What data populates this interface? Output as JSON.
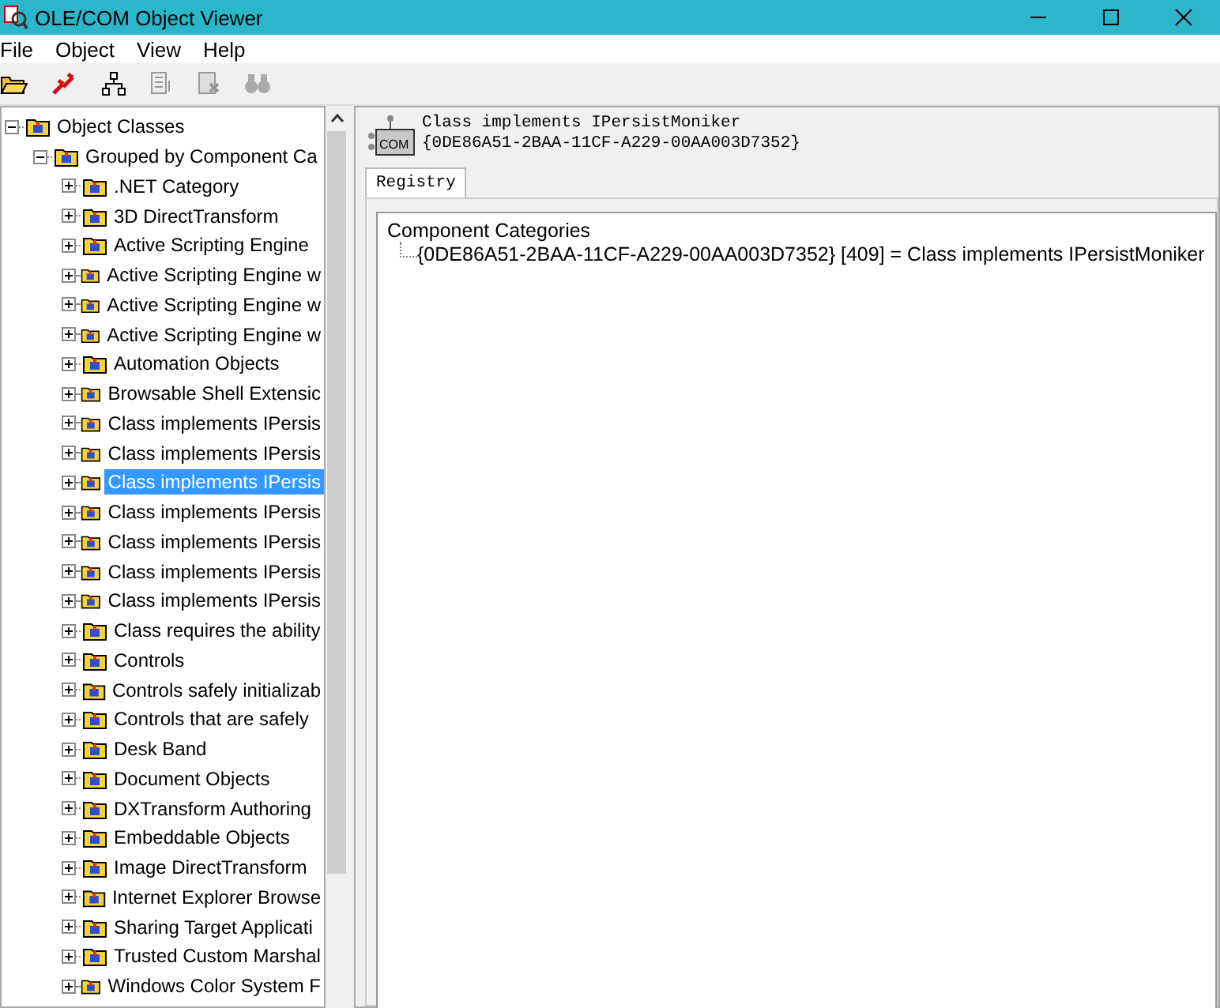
{
  "window": {
    "title": "OLE/COM Object Viewer"
  },
  "menu": [
    "File",
    "Object",
    "View",
    "Help"
  ],
  "tree": [
    {
      "label": "Object Classes",
      "expanded": true,
      "selected": false,
      "children": [
        {
          "label": "Grouped by Component Ca",
          "expanded": true,
          "selected": false,
          "children": [
            {
              "label": ".NET Category",
              "expanded": false,
              "selected": false
            },
            {
              "label": "3D DirectTransform",
              "expanded": false,
              "selected": false
            },
            {
              "label": "Active Scripting Engine",
              "expanded": false,
              "selected": false
            },
            {
              "label": "Active Scripting Engine w",
              "expanded": false,
              "selected": false
            },
            {
              "label": "Active Scripting Engine w",
              "expanded": false,
              "selected": false
            },
            {
              "label": "Active Scripting Engine w",
              "expanded": false,
              "selected": false
            },
            {
              "label": "Automation Objects",
              "expanded": false,
              "selected": false
            },
            {
              "label": "Browsable Shell Extensic",
              "expanded": false,
              "selected": false
            },
            {
              "label": "Class implements IPersis",
              "expanded": false,
              "selected": false
            },
            {
              "label": "Class implements IPersis",
              "expanded": false,
              "selected": false
            },
            {
              "label": "Class implements IPersis",
              "expanded": false,
              "selected": true
            },
            {
              "label": "Class implements IPersis",
              "expanded": false,
              "selected": false
            },
            {
              "label": "Class implements IPersis",
              "expanded": false,
              "selected": false
            },
            {
              "label": "Class implements IPersis",
              "expanded": false,
              "selected": false
            },
            {
              "label": "Class implements IPersis",
              "expanded": false,
              "selected": false
            },
            {
              "label": "Class requires the ability",
              "expanded": false,
              "selected": false
            },
            {
              "label": "Controls",
              "expanded": false,
              "selected": false
            },
            {
              "label": "Controls safely initializab",
              "expanded": false,
              "selected": false
            },
            {
              "label": "Controls that are safely",
              "expanded": false,
              "selected": false
            },
            {
              "label": "Desk Band",
              "expanded": false,
              "selected": false
            },
            {
              "label": "Document Objects",
              "expanded": false,
              "selected": false
            },
            {
              "label": "DXTransform Authoring",
              "expanded": false,
              "selected": false
            },
            {
              "label": "Embeddable Objects",
              "expanded": false,
              "selected": false
            },
            {
              "label": "Image DirectTransform",
              "expanded": false,
              "selected": false
            },
            {
              "label": "Internet Explorer Browse",
              "expanded": false,
              "selected": false
            },
            {
              "label": "Sharing Target Applicati",
              "expanded": false,
              "selected": false
            },
            {
              "label": "Trusted Custom Marshal",
              "expanded": false,
              "selected": false
            },
            {
              "label": "Windows Color System F",
              "expanded": false,
              "selected": false
            }
          ]
        }
      ]
    }
  ],
  "detail": {
    "icon_label": "COM",
    "name": "Class implements IPersistMoniker",
    "clsid": "{0DE86A51-2BAA-11CF-A229-00AA003D7352}",
    "tabs": [
      {
        "label": "Registry",
        "selected": true
      }
    ],
    "registry": [
      {
        "label": "Component Categories",
        "children": [
          {
            "label": "{0DE86A51-2BAA-11CF-A229-00AA003D7352} [409] = Class implements IPersistMoniker"
          }
        ]
      }
    ]
  }
}
